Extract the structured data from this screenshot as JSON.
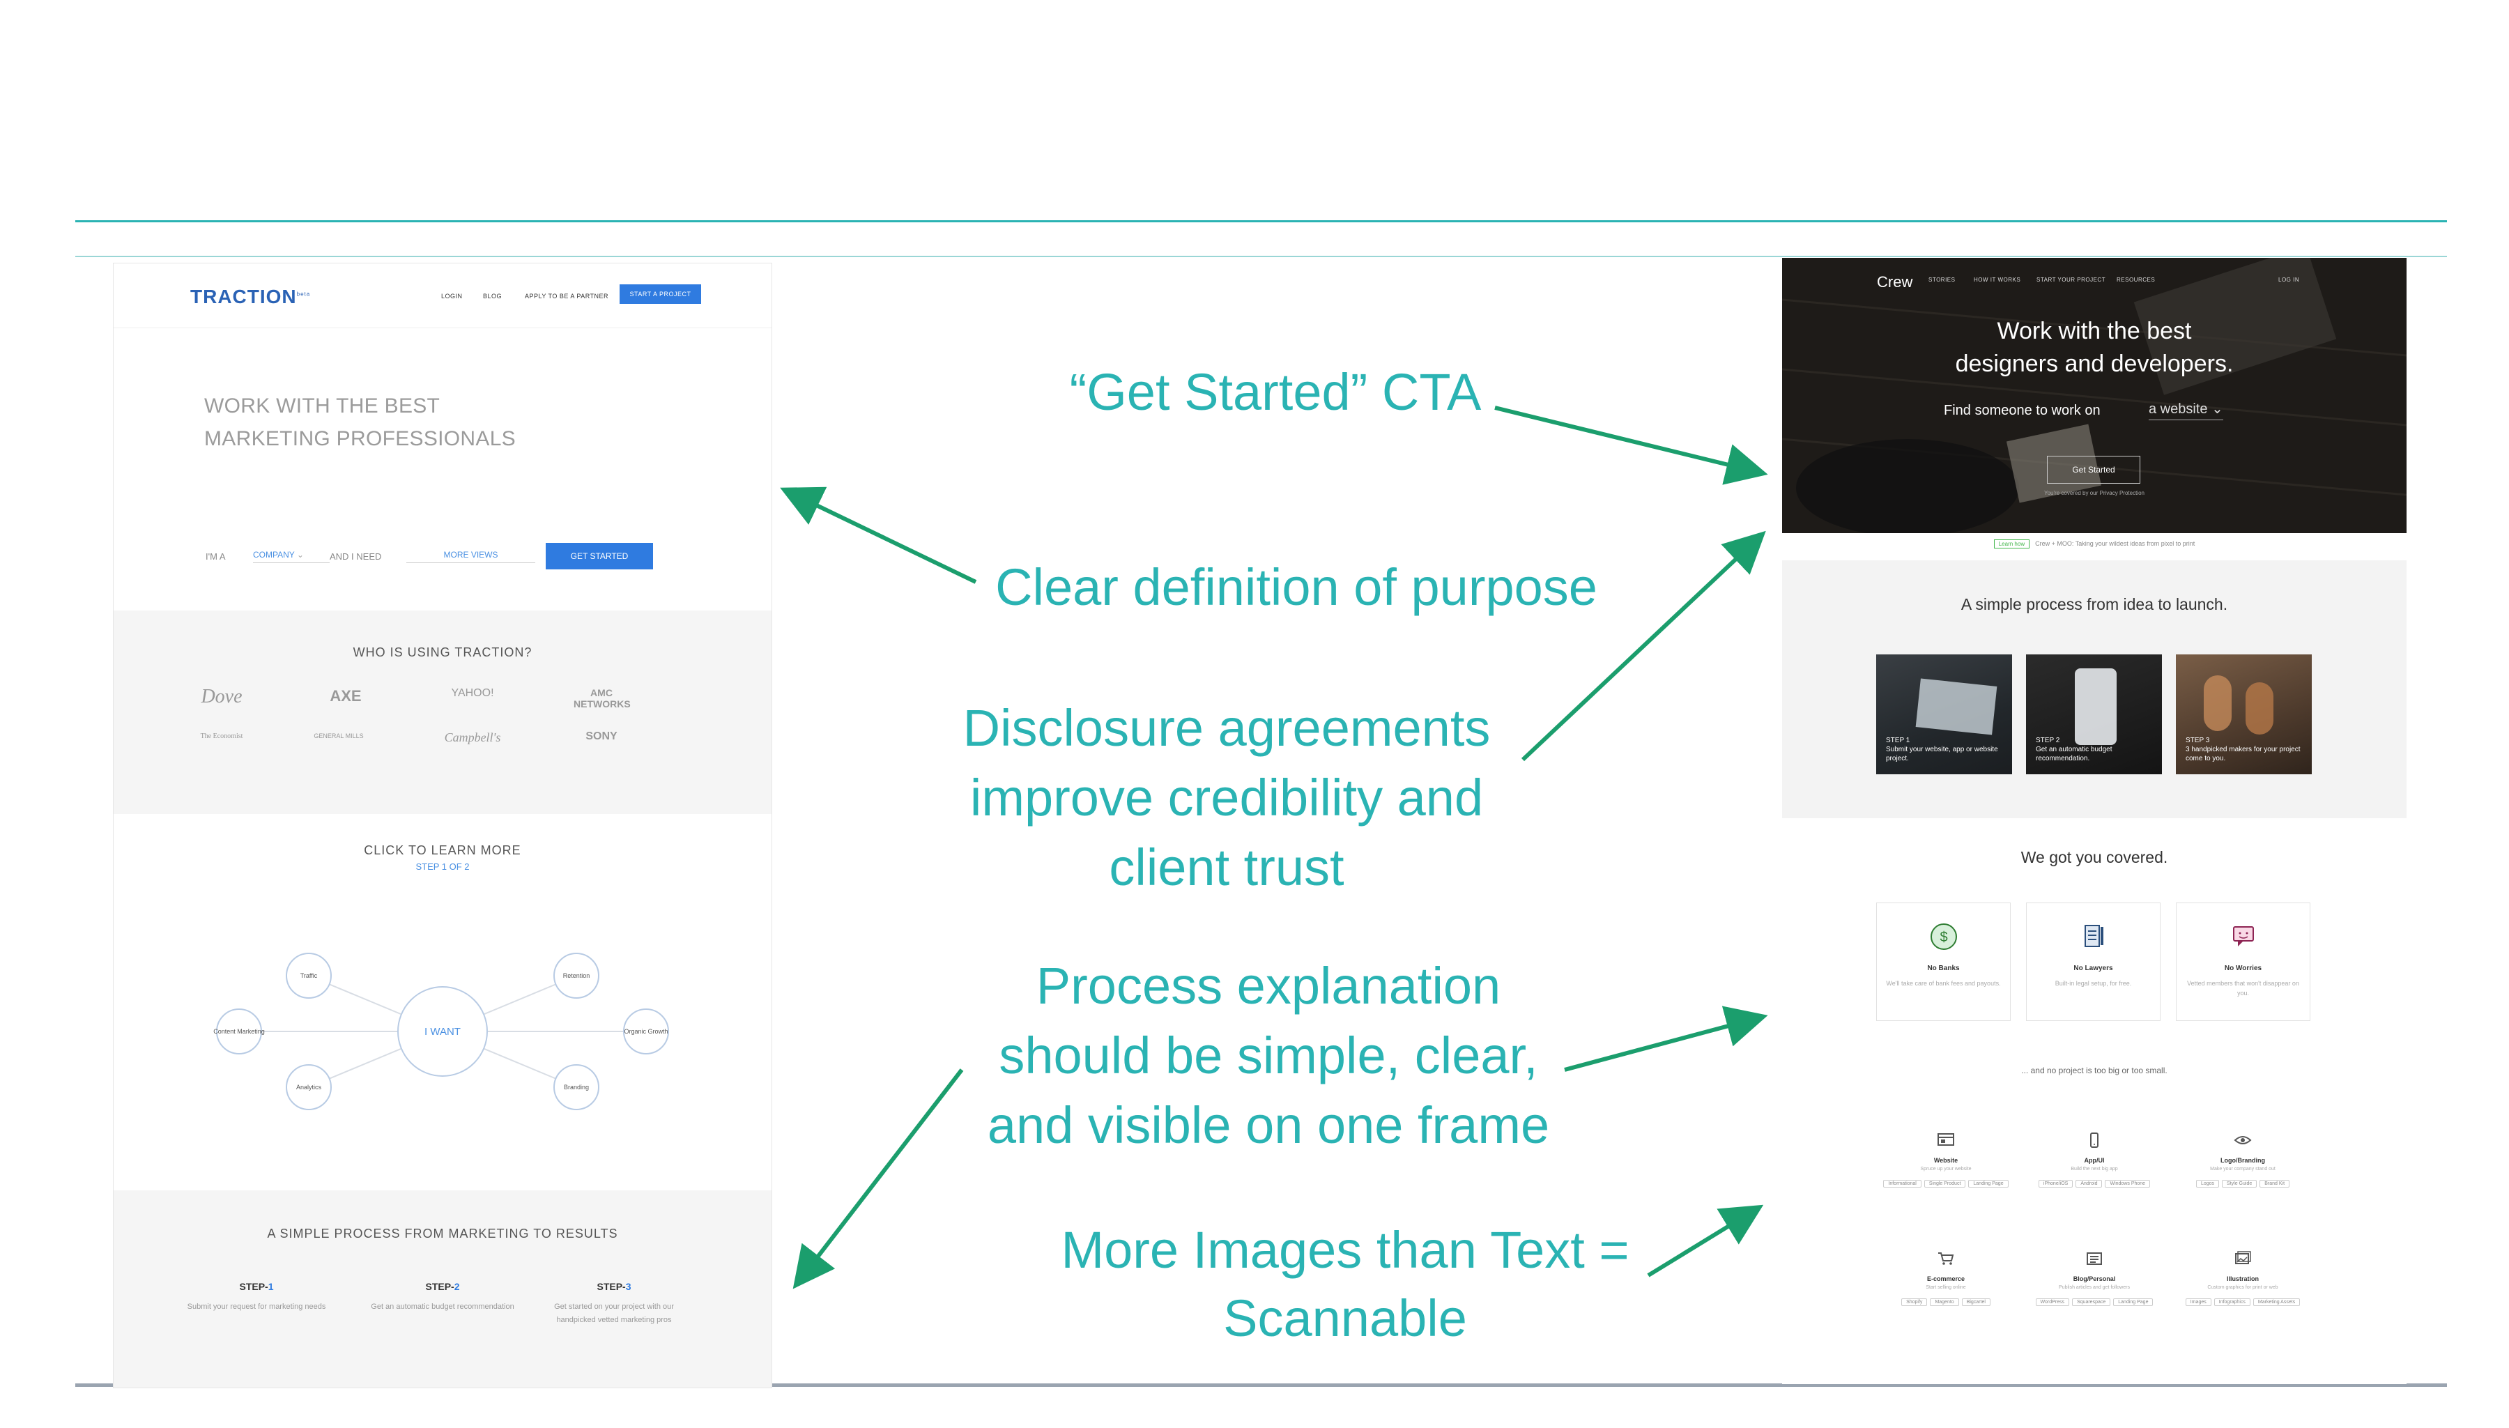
{
  "colors": {
    "annotation_text": "#2ab3b3",
    "arrow": "#1b9e6d",
    "rule": "#2ab3b3"
  },
  "traction": {
    "logo": "TRACTION",
    "logo_sup": "beta",
    "nav": [
      "LOGIN",
      "BLOG",
      "APPLY TO BE A PARTNER"
    ],
    "nav_cta": "START A PROJECT",
    "hero_title_line1": "WORK WITH THE BEST",
    "hero_title_line2": "MARKETING PROFESSIONALS",
    "im_a": "I'M A",
    "company": "COMPANY",
    "and_i_need": "AND I NEED",
    "more_views": "MORE VIEWS",
    "get_started": "GET STARTED",
    "clients_title": "WHO IS USING TRACTION?",
    "clients": [
      "Dove",
      "AXE",
      "YAHOO!",
      "AMC NETWORKS",
      "The Economist",
      "GENERAL MILLS",
      "Campbell's",
      "SONY"
    ],
    "learn_title": "CLICK TO LEARN MORE",
    "learn_step": "STEP 1 OF 2",
    "center_node": "I WANT",
    "nodes": [
      "Traffic",
      "Retention",
      "Content Marketing",
      "Organic Growth",
      "Analytics",
      "Branding"
    ],
    "process_title": "A SIMPLE PROCESS FROM MARKETING TO RESULTS",
    "steps": [
      {
        "label": "STEP-",
        "num": "1",
        "desc": "Submit your request for marketing needs"
      },
      {
        "label": "STEP-",
        "num": "2",
        "desc": "Get an automatic budget recommendation"
      },
      {
        "label": "STEP-",
        "num": "3",
        "desc": "Get started on your project with our handpicked vetted marketing pros"
      }
    ]
  },
  "annotations": {
    "cta": "“Get Started” CTA",
    "purpose": "Clear definition of purpose",
    "disclosure_line1": "Disclosure agreements",
    "disclosure_line2": "improve credibility and",
    "disclosure_line3": "client trust",
    "process_line1": "Process explanation",
    "process_line2": "should be simple, clear,",
    "process_line3": "and visible on one frame",
    "images_line1": "More Images than Text =",
    "images_line2": "Scannable"
  },
  "crew": {
    "logo": "Crew",
    "nav": [
      "STORIES",
      "HOW IT WORKS",
      "START YOUR PROJECT",
      "RESOURCES"
    ],
    "login": "LOG IN",
    "hero_title_line1": "Work with the best",
    "hero_title_line2": "designers and developers.",
    "find": "Find someone to work on",
    "select_value": "a website",
    "get_started": "Get Started",
    "hero_note": "You're covered by our Privacy Protection",
    "strip_badge": "Learn how",
    "strip_text": "Crew + MOO: Taking your wildest ideas from pixel to print",
    "process_title": "A simple process from idea to launch.",
    "photos": [
      {
        "step": "STEP 1",
        "caption": "Submit your website, app or website project."
      },
      {
        "step": "STEP 2",
        "caption": "Get an automatic budget recommendation."
      },
      {
        "step": "STEP 3",
        "caption": "3 handpicked makers for your project come to you."
      }
    ],
    "covered_title": "We got you covered.",
    "cards": [
      {
        "icon": "dollar-icon",
        "title": "No Banks",
        "desc": "We'll take care of bank fees and payouts."
      },
      {
        "icon": "document-icon",
        "title": "No Lawyers",
        "desc": "Built-in legal setup, for free."
      },
      {
        "icon": "chat-icon",
        "title": "No Worries",
        "desc": "Vetted members that won't disappear on you."
      }
    ],
    "tagline": "... and no project is too big or too small.",
    "types": [
      {
        "icon": "website-icon",
        "title": "Website",
        "desc": "Spruce up your website",
        "chips": [
          "Informational",
          "Single Product",
          "Landing Page"
        ]
      },
      {
        "icon": "phone-icon",
        "title": "App/UI",
        "desc": "Build the next big app",
        "chips": [
          "iPhone/iOS",
          "Android",
          "Windows Phone"
        ]
      },
      {
        "icon": "eye-icon",
        "title": "Logo/Branding",
        "desc": "Make your company stand out",
        "chips": [
          "Logos",
          "Style Guide",
          "Brand Kit"
        ]
      },
      {
        "icon": "cart-icon",
        "title": "E-commerce",
        "desc": "Start selling online",
        "chips": [
          "Shopify",
          "Magento",
          "Bigcartel"
        ]
      },
      {
        "icon": "blog-icon",
        "title": "Blog/Personal",
        "desc": "Publish articles and get followers",
        "chips": [
          "WordPress",
          "Squarespace",
          "Landing Page"
        ]
      },
      {
        "icon": "picture-icon",
        "title": "Illustration",
        "desc": "Custom graphics for print or web",
        "chips": [
          "Images",
          "Infographics",
          "Marketing Assets"
        ]
      }
    ]
  }
}
